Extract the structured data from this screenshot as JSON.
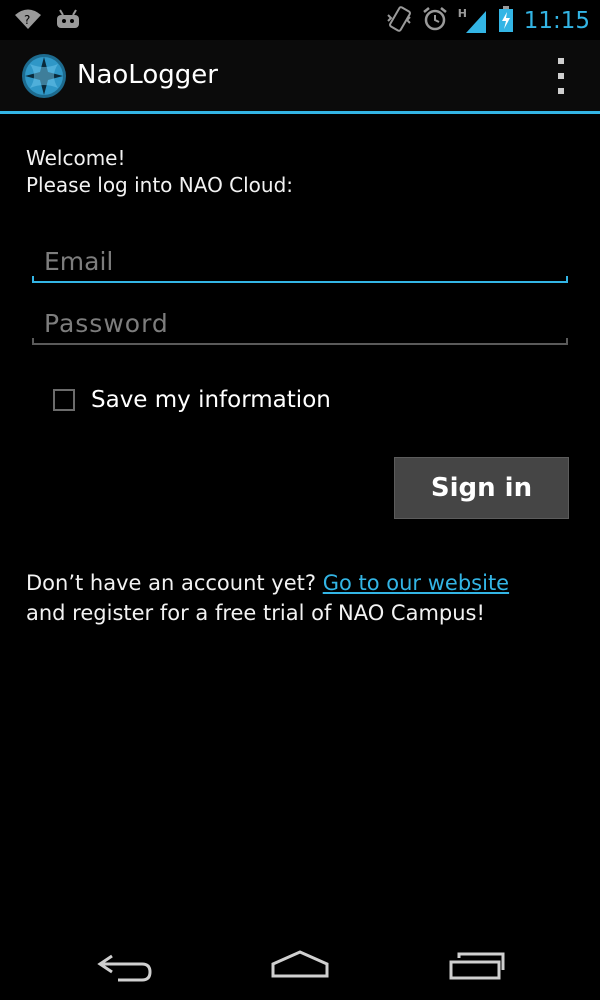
{
  "status_bar": {
    "time": "11:15",
    "network_label": "H",
    "left_icons": [
      "wifi-question-icon",
      "android-debug-icon"
    ],
    "right_icons": [
      "vibrate-icon",
      "alarm-icon",
      "signal-icon",
      "battery-charging-icon"
    ]
  },
  "action_bar": {
    "title": "NaoLogger",
    "logo_icon": "nao-logo-icon",
    "menu_icon": "overflow-menu-icon"
  },
  "login": {
    "welcome_line1": "Welcome!",
    "welcome_line2": "Please log into NAO Cloud:",
    "email_placeholder": "Email",
    "email_value": "",
    "password_placeholder": "Password",
    "password_value": "",
    "save_label": "Save my information",
    "save_checked": false,
    "signin_label": "Sign in",
    "register_prefix": "Don’t have an account yet? ",
    "register_link": "Go to our website",
    "register_suffix": "and register for a free trial of NAO Campus!"
  },
  "nav_bar": {
    "icons": [
      "back-icon",
      "home-icon",
      "recent-apps-icon"
    ]
  },
  "colors": {
    "accent": "#33b5e5",
    "background": "#000000",
    "button": "#454545"
  }
}
